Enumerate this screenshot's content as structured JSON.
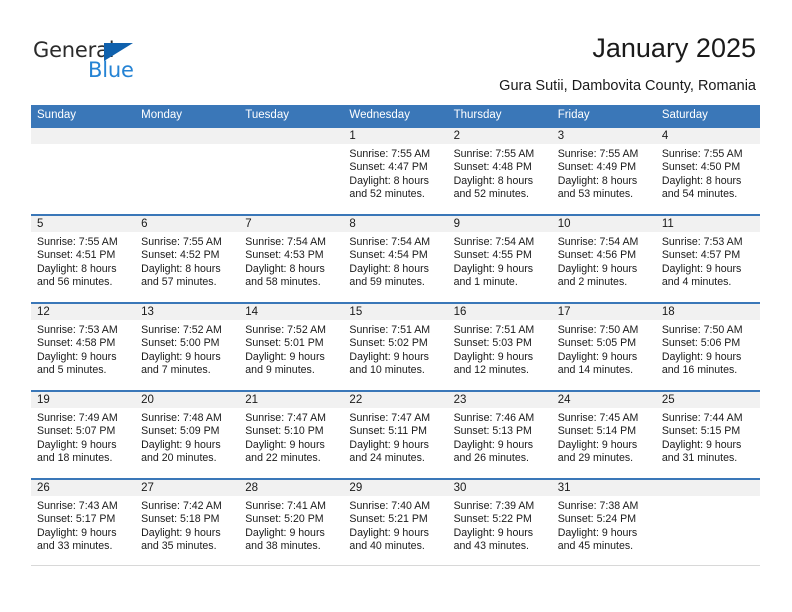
{
  "brand": {
    "word_one": "General",
    "word_two": "Blue",
    "triangle_color": "#1061ad",
    "blue_color": "#2583d4"
  },
  "header": {
    "title": "January 2025",
    "subtitle": "Gura Sutii, Dambovita County, Romania"
  },
  "theme": {
    "header_blue": "#3a77b8",
    "day_head_gray": "#f1f1f1"
  },
  "weekdays": [
    "Sunday",
    "Monday",
    "Tuesday",
    "Wednesday",
    "Thursday",
    "Friday",
    "Saturday"
  ],
  "weeks": [
    [
      {
        "day": "",
        "empty": true,
        "sunrise": "",
        "sunset": "",
        "daylight_1": "",
        "daylight_2": ""
      },
      {
        "day": "",
        "empty": true,
        "sunrise": "",
        "sunset": "",
        "daylight_1": "",
        "daylight_2": ""
      },
      {
        "day": "",
        "empty": true,
        "sunrise": "",
        "sunset": "",
        "daylight_1": "",
        "daylight_2": ""
      },
      {
        "day": "1",
        "sunrise": "Sunrise: 7:55 AM",
        "sunset": "Sunset: 4:47 PM",
        "daylight_1": "Daylight: 8 hours",
        "daylight_2": "and 52 minutes."
      },
      {
        "day": "2",
        "sunrise": "Sunrise: 7:55 AM",
        "sunset": "Sunset: 4:48 PM",
        "daylight_1": "Daylight: 8 hours",
        "daylight_2": "and 52 minutes."
      },
      {
        "day": "3",
        "sunrise": "Sunrise: 7:55 AM",
        "sunset": "Sunset: 4:49 PM",
        "daylight_1": "Daylight: 8 hours",
        "daylight_2": "and 53 minutes."
      },
      {
        "day": "4",
        "sunrise": "Sunrise: 7:55 AM",
        "sunset": "Sunset: 4:50 PM",
        "daylight_1": "Daylight: 8 hours",
        "daylight_2": "and 54 minutes."
      }
    ],
    [
      {
        "day": "5",
        "sunrise": "Sunrise: 7:55 AM",
        "sunset": "Sunset: 4:51 PM",
        "daylight_1": "Daylight: 8 hours",
        "daylight_2": "and 56 minutes."
      },
      {
        "day": "6",
        "sunrise": "Sunrise: 7:55 AM",
        "sunset": "Sunset: 4:52 PM",
        "daylight_1": "Daylight: 8 hours",
        "daylight_2": "and 57 minutes."
      },
      {
        "day": "7",
        "sunrise": "Sunrise: 7:54 AM",
        "sunset": "Sunset: 4:53 PM",
        "daylight_1": "Daylight: 8 hours",
        "daylight_2": "and 58 minutes."
      },
      {
        "day": "8",
        "sunrise": "Sunrise: 7:54 AM",
        "sunset": "Sunset: 4:54 PM",
        "daylight_1": "Daylight: 8 hours",
        "daylight_2": "and 59 minutes."
      },
      {
        "day": "9",
        "sunrise": "Sunrise: 7:54 AM",
        "sunset": "Sunset: 4:55 PM",
        "daylight_1": "Daylight: 9 hours",
        "daylight_2": "and 1 minute."
      },
      {
        "day": "10",
        "sunrise": "Sunrise: 7:54 AM",
        "sunset": "Sunset: 4:56 PM",
        "daylight_1": "Daylight: 9 hours",
        "daylight_2": "and 2 minutes."
      },
      {
        "day": "11",
        "sunrise": "Sunrise: 7:53 AM",
        "sunset": "Sunset: 4:57 PM",
        "daylight_1": "Daylight: 9 hours",
        "daylight_2": "and 4 minutes."
      }
    ],
    [
      {
        "day": "12",
        "sunrise": "Sunrise: 7:53 AM",
        "sunset": "Sunset: 4:58 PM",
        "daylight_1": "Daylight: 9 hours",
        "daylight_2": "and 5 minutes."
      },
      {
        "day": "13",
        "sunrise": "Sunrise: 7:52 AM",
        "sunset": "Sunset: 5:00 PM",
        "daylight_1": "Daylight: 9 hours",
        "daylight_2": "and 7 minutes."
      },
      {
        "day": "14",
        "sunrise": "Sunrise: 7:52 AM",
        "sunset": "Sunset: 5:01 PM",
        "daylight_1": "Daylight: 9 hours",
        "daylight_2": "and 9 minutes."
      },
      {
        "day": "15",
        "sunrise": "Sunrise: 7:51 AM",
        "sunset": "Sunset: 5:02 PM",
        "daylight_1": "Daylight: 9 hours",
        "daylight_2": "and 10 minutes."
      },
      {
        "day": "16",
        "sunrise": "Sunrise: 7:51 AM",
        "sunset": "Sunset: 5:03 PM",
        "daylight_1": "Daylight: 9 hours",
        "daylight_2": "and 12 minutes."
      },
      {
        "day": "17",
        "sunrise": "Sunrise: 7:50 AM",
        "sunset": "Sunset: 5:05 PM",
        "daylight_1": "Daylight: 9 hours",
        "daylight_2": "and 14 minutes."
      },
      {
        "day": "18",
        "sunrise": "Sunrise: 7:50 AM",
        "sunset": "Sunset: 5:06 PM",
        "daylight_1": "Daylight: 9 hours",
        "daylight_2": "and 16 minutes."
      }
    ],
    [
      {
        "day": "19",
        "sunrise": "Sunrise: 7:49 AM",
        "sunset": "Sunset: 5:07 PM",
        "daylight_1": "Daylight: 9 hours",
        "daylight_2": "and 18 minutes."
      },
      {
        "day": "20",
        "sunrise": "Sunrise: 7:48 AM",
        "sunset": "Sunset: 5:09 PM",
        "daylight_1": "Daylight: 9 hours",
        "daylight_2": "and 20 minutes."
      },
      {
        "day": "21",
        "sunrise": "Sunrise: 7:47 AM",
        "sunset": "Sunset: 5:10 PM",
        "daylight_1": "Daylight: 9 hours",
        "daylight_2": "and 22 minutes."
      },
      {
        "day": "22",
        "sunrise": "Sunrise: 7:47 AM",
        "sunset": "Sunset: 5:11 PM",
        "daylight_1": "Daylight: 9 hours",
        "daylight_2": "and 24 minutes."
      },
      {
        "day": "23",
        "sunrise": "Sunrise: 7:46 AM",
        "sunset": "Sunset: 5:13 PM",
        "daylight_1": "Daylight: 9 hours",
        "daylight_2": "and 26 minutes."
      },
      {
        "day": "24",
        "sunrise": "Sunrise: 7:45 AM",
        "sunset": "Sunset: 5:14 PM",
        "daylight_1": "Daylight: 9 hours",
        "daylight_2": "and 29 minutes."
      },
      {
        "day": "25",
        "sunrise": "Sunrise: 7:44 AM",
        "sunset": "Sunset: 5:15 PM",
        "daylight_1": "Daylight: 9 hours",
        "daylight_2": "and 31 minutes."
      }
    ],
    [
      {
        "day": "26",
        "sunrise": "Sunrise: 7:43 AM",
        "sunset": "Sunset: 5:17 PM",
        "daylight_1": "Daylight: 9 hours",
        "daylight_2": "and 33 minutes."
      },
      {
        "day": "27",
        "sunrise": "Sunrise: 7:42 AM",
        "sunset": "Sunset: 5:18 PM",
        "daylight_1": "Daylight: 9 hours",
        "daylight_2": "and 35 minutes."
      },
      {
        "day": "28",
        "sunrise": "Sunrise: 7:41 AM",
        "sunset": "Sunset: 5:20 PM",
        "daylight_1": "Daylight: 9 hours",
        "daylight_2": "and 38 minutes."
      },
      {
        "day": "29",
        "sunrise": "Sunrise: 7:40 AM",
        "sunset": "Sunset: 5:21 PM",
        "daylight_1": "Daylight: 9 hours",
        "daylight_2": "and 40 minutes."
      },
      {
        "day": "30",
        "sunrise": "Sunrise: 7:39 AM",
        "sunset": "Sunset: 5:22 PM",
        "daylight_1": "Daylight: 9 hours",
        "daylight_2": "and 43 minutes."
      },
      {
        "day": "31",
        "sunrise": "Sunrise: 7:38 AM",
        "sunset": "Sunset: 5:24 PM",
        "daylight_1": "Daylight: 9 hours",
        "daylight_2": "and 45 minutes."
      },
      {
        "day": "",
        "empty": true,
        "sunrise": "",
        "sunset": "",
        "daylight_1": "",
        "daylight_2": ""
      }
    ]
  ]
}
